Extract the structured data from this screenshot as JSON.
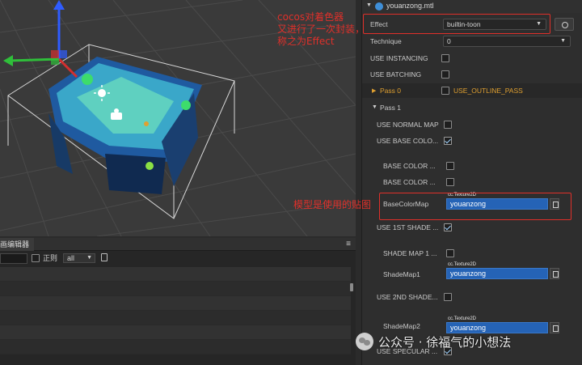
{
  "inspector": {
    "file_name": "youanzong.mtl",
    "effect": {
      "label": "Effect",
      "value": "builtin-toon"
    },
    "technique": {
      "label": "Technique",
      "value": "0"
    },
    "use_instancing": {
      "label": "USE INSTANCING",
      "checked": false
    },
    "use_batching": {
      "label": "USE BATCHING",
      "checked": false
    },
    "pass0": {
      "label": "Pass 0",
      "option_label": "USE_OUTLINE_PASS",
      "checked": false
    },
    "pass1": {
      "label": "Pass 1",
      "use_normal_map": {
        "label": "USE NORMAL MAP",
        "checked": false
      },
      "use_base_color": {
        "label": "USE BASE COLO...",
        "checked": true
      },
      "base_color_a": {
        "label": "BASE COLOR ...",
        "checked": false
      },
      "base_color_b": {
        "label": "BASE COLOR ...",
        "checked": false
      },
      "base_color_map": {
        "label": "BaseColorMap",
        "tag": "cc.Texture2D",
        "value": "youanzong"
      },
      "use_1st_shade": {
        "label": "USE 1ST SHADE ...",
        "checked": true
      },
      "shade_map_1_opt": {
        "label": "SHADE MAP 1 ...",
        "checked": false
      },
      "shade_map1": {
        "label": "ShadeMap1",
        "tag": "cc.Texture2D",
        "value": "youanzong"
      },
      "use_2nd_shade": {
        "label": "USE 2ND SHADE...",
        "checked": false
      },
      "shade_map2": {
        "label": "ShadeMap2",
        "tag": "cc.Texture2D",
        "value": "youanzong"
      },
      "use_specular": {
        "label": "USE SPECULAR ...",
        "checked": true
      }
    }
  },
  "animation_panel": {
    "tab_title": "画编辑器",
    "menu_glyph": "≡",
    "regex_label": "正则",
    "filter_value": "all",
    "row_label": "e"
  },
  "annotations": {
    "effect_note": [
      "cocos对着色器",
      "又进行了一次封装，",
      "称之为Effect"
    ],
    "texture_note": "模型是使用的贴图"
  },
  "watermark": {
    "text": "公众号 · 徐福气的小想法"
  },
  "colors": {
    "accent_blue": "#2563b6",
    "annotation_red": "#e0302a"
  }
}
